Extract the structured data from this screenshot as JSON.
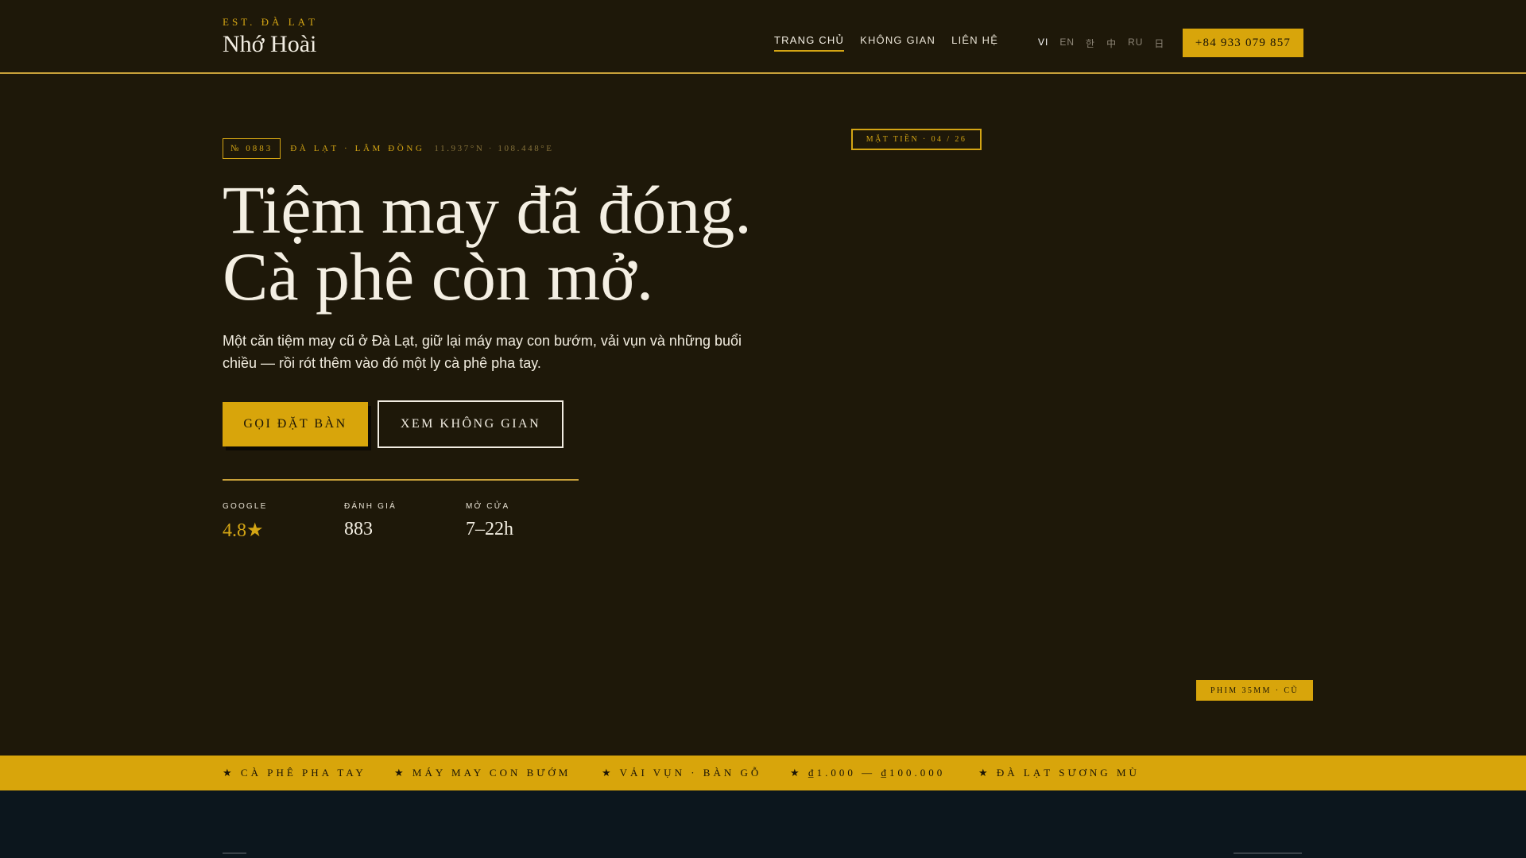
{
  "brand": {
    "est": "EST. ĐÀ LẠT",
    "name": "Nhớ Hoài"
  },
  "nav": {
    "items": [
      "TRANG CHỦ",
      "KHÔNG GIAN",
      "LIÊN HỆ"
    ],
    "active": "TRANG CHỦ"
  },
  "langs": [
    "VI",
    "EN",
    "한",
    "中",
    "RU",
    "日"
  ],
  "lang_selected": "VI",
  "phone": "+84 933 079 857",
  "hero": {
    "ref_no": "№ 0883",
    "ref_place": "ĐÀ LẠT · LÂM ĐỒNG",
    "ref_coord": "11.937°N · 108.448°E",
    "title_line1": "Tiệm may đã đóng.",
    "title_line2": "Cà phê còn mở.",
    "desc": "Một căn tiệm may cũ ở Đà Lạt, giữ lại máy may con bướm, vải vụn và những buổi chiều — rồi rót thêm vào đó một ly cà phê pha tay.",
    "cta_primary": "GỌI ĐẶT BÀN",
    "cta_secondary": "XEM KHÔNG GIAN"
  },
  "stats": [
    {
      "label": "GOOGLE",
      "value": "4.8★"
    },
    {
      "label": "ĐÁNH GIÁ",
      "value": "883"
    },
    {
      "label": "MỞ CỬA",
      "value": "7–22h"
    }
  ],
  "tags": {
    "front": "MẶT TIỀN · 04 / 26",
    "film": "PHIM 35MM · CŨ"
  },
  "ticker": [
    "★ CÀ PHÊ PHA TAY",
    "★ MÁY MAY CON BƯỚM",
    "★ VẢI VỤN · BÀN GỖ",
    "★ ₫1.000 — ₫100.000",
    "★ ĐÀ LẠT SƯƠNG MÙ"
  ],
  "colors": {
    "background": "#1e1809",
    "accent": "#d8a50b",
    "section_dark": "#0c161d",
    "text": "#f2ede2"
  }
}
